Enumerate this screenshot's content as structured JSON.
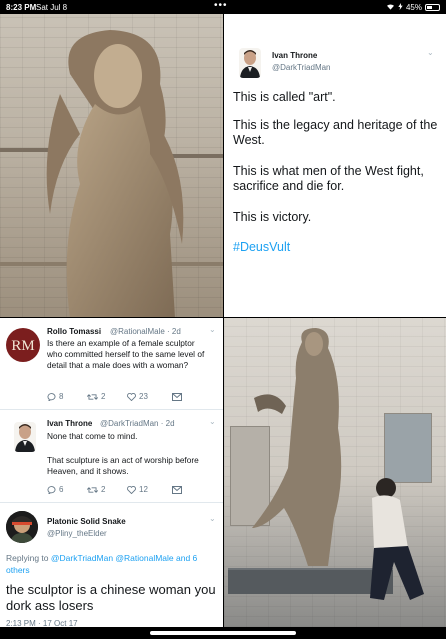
{
  "status_bar": {
    "time": "8:23 PM",
    "date": "Sat Jul 8",
    "dots": "•••",
    "battery": "45%",
    "battery_level": 0.45
  },
  "tweet_main": {
    "name": "Ivan Throne",
    "handle": "@DarkTriadMan",
    "lines": [
      "This is called \"art\".",
      "This is the legacy and heritage of the West.",
      "This is what men of the West fight, sacrifice and die for.",
      "This is victory."
    ],
    "hashtag": "#DeusVult"
  },
  "reply_rollo": {
    "name": "Rollo Tomassi",
    "handle_time": "@RationalMale · 2d",
    "avatar_text": "RM",
    "text": "Is there an example of a female sculptor who committed herself to the same level of detail that a male does with a woman?",
    "replies": "8",
    "retweets": "2",
    "likes": "23"
  },
  "reply_ivan": {
    "name": "Ivan Throne",
    "handle_time": "@DarkTriadMan · 2d",
    "text1": "None that come to mind.",
    "text2": "That sculpture is an act of worship before Heaven, and it shows.",
    "replies": "6",
    "retweets": "2",
    "likes": "12"
  },
  "reply_platonic": {
    "name": "Platonic Solid Snake",
    "handle": "@Pliny_theElder",
    "replying_prefix": "Replying to ",
    "replying_links": "@DarkTriadMan @RationalMale",
    "replying_suffix": " and 6 others",
    "text": "the sculptor is a chinese woman you dork ass losers",
    "timestamp": "2:13 PM · 17 Oct 17"
  },
  "colors": {
    "link": "#1da1f2",
    "muted": "#657786",
    "rm_avatar": "#7b1e1e"
  }
}
